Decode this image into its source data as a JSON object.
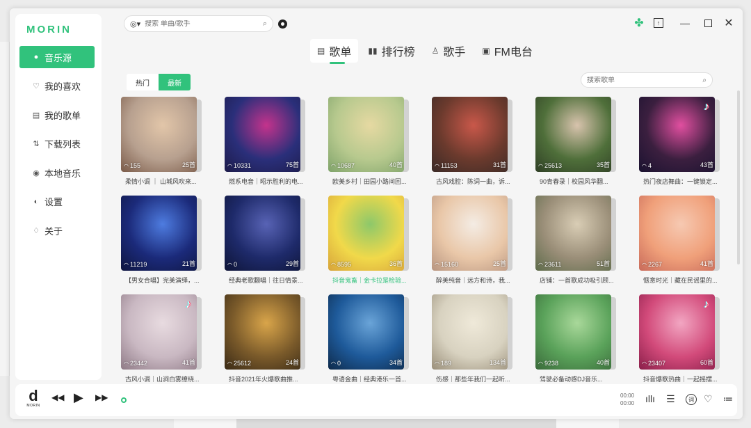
{
  "app": {
    "logo": "MORIN",
    "search_source_icon": "netease-icon",
    "search_placeholder": "搜索 单曲/歌手"
  },
  "colors": {
    "accent": "#31c27c"
  },
  "sidebar": {
    "items": [
      {
        "label": "音乐源",
        "icon": "music-source-icon",
        "active": true
      },
      {
        "label": "我的喜欢",
        "icon": "heart-icon"
      },
      {
        "label": "我的歌单",
        "icon": "playlist-icon"
      },
      {
        "label": "下载列表",
        "icon": "download-icon"
      },
      {
        "label": "本地音乐",
        "icon": "local-music-icon"
      },
      {
        "label": "设置",
        "icon": "settings-icon"
      },
      {
        "label": "关于",
        "icon": "bulb-icon"
      }
    ]
  },
  "tabs": [
    {
      "label": "歌单",
      "icon": "playlist-icon",
      "active": true
    },
    {
      "label": "排行榜",
      "icon": "chart-icon"
    },
    {
      "label": "歌手",
      "icon": "singer-icon"
    },
    {
      "label": "FM电台",
      "icon": "radio-icon"
    }
  ],
  "subtabs": [
    {
      "label": "热门"
    },
    {
      "label": "最新",
      "active": true
    }
  ],
  "playlist_search_placeholder": "搜索歌单",
  "playlists": [
    {
      "plays": "155",
      "count": "25首",
      "title": "柔情小调 ｜ 山城风吹来...",
      "colors": [
        "#b7a08f",
        "#e2c6a9",
        "#7a5a48"
      ]
    },
    {
      "plays": "10331",
      "count": "75首",
      "title": "燃系电音｜昭示胜利的电...",
      "colors": [
        "#2a2f7a",
        "#c4338c",
        "#1d1b4a"
      ]
    },
    {
      "plays": "10687",
      "count": "40首",
      "title": "欧美乡村｜田园小路间回...",
      "colors": [
        "#b7c98e",
        "#e6d9a2",
        "#7fa36a"
      ]
    },
    {
      "plays": "11153",
      "count": "31首",
      "title": "古风戏腔：陈词一曲，诉...",
      "colors": [
        "#6b3a2d",
        "#c9584a",
        "#3a2a26"
      ]
    },
    {
      "plays": "25613",
      "count": "35首",
      "title": "90青春录｜校园风华翻...",
      "colors": [
        "#4f6f3a",
        "#d8c3ad",
        "#2f3f25"
      ]
    },
    {
      "plays": "4",
      "count": "43首",
      "title": "热门夜店舞曲：一键锁定...",
      "colors": [
        "#3b1f3f",
        "#e14fa0",
        "#1a1230"
      ],
      "tiktok": true
    },
    {
      "plays": "11219",
      "count": "21首",
      "title": "【男女合唱】完美演绎，...",
      "colors": [
        "#1b2a7a",
        "#4e7ce0",
        "#0f1640"
      ]
    },
    {
      "plays": "0",
      "count": "29首",
      "title": "经典老歌翻唱｜往日情景...",
      "colors": [
        "#1e2a6a",
        "#5863b5",
        "#0e1436"
      ]
    },
    {
      "plays": "8595",
      "count": "36首",
      "title": "抖音鬼畜｜金卡拉是检验...",
      "colors": [
        "#f1d94a",
        "#8dc86a",
        "#d7a33a"
      ],
      "highlight": true
    },
    {
      "plays": "15160",
      "count": "25首",
      "title": "醉美纯音｜远方和诗，我...",
      "colors": [
        "#e9c7a8",
        "#f4ece4",
        "#b89580"
      ]
    },
    {
      "plays": "23611",
      "count": "51首",
      "title": "店铺：一首歌成功吸引顾...",
      "colors": [
        "#9a8e78",
        "#d9cdb5",
        "#5d6b4a"
      ]
    },
    {
      "plays": "2267",
      "count": "41首",
      "title": "惬意时光｜藏在民谣里的...",
      "colors": [
        "#f0a07a",
        "#f6c9b2",
        "#c86a5a"
      ]
    },
    {
      "plays": "23442",
      "count": "41首",
      "title": "古风小调｜山涧白雾缭绕...",
      "colors": [
        "#c9b8c2",
        "#e8dbe0",
        "#8f7a86"
      ],
      "tiktok": true
    },
    {
      "plays": "25612",
      "count": "24首",
      "title": "抖音2021年火爆歌曲推...",
      "colors": [
        "#7a5a2a",
        "#d9a54a",
        "#3a2a16"
      ]
    },
    {
      "plays": "0",
      "count": "34首",
      "title": "粤语金曲｜经典港乐一首...",
      "colors": [
        "#1e5a9a",
        "#6aa4d8",
        "#0e2a4a"
      ]
    },
    {
      "plays": "189",
      "count": "134首",
      "title": "伤感｜那些年我们一起听...",
      "colors": [
        "#d8d2c0",
        "#efe9d9",
        "#9a8f7a"
      ]
    },
    {
      "plays": "9238",
      "count": "40首",
      "title": "驾驶必备动感DJ音乐...",
      "colors": [
        "#5aa25a",
        "#a9d89a",
        "#3a6a3a"
      ]
    },
    {
      "plays": "23407",
      "count": "60首",
      "title": "抖音爆歌热曲｜一起摇摆...",
      "colors": [
        "#d24a7a",
        "#f2a6c2",
        "#8a1f4a"
      ],
      "tiktok": true
    }
  ],
  "player": {
    "logo_letter": "d",
    "logo_text": "MORIN",
    "time_current": "00:00",
    "time_total": "00:00",
    "lyric_label": "词"
  }
}
